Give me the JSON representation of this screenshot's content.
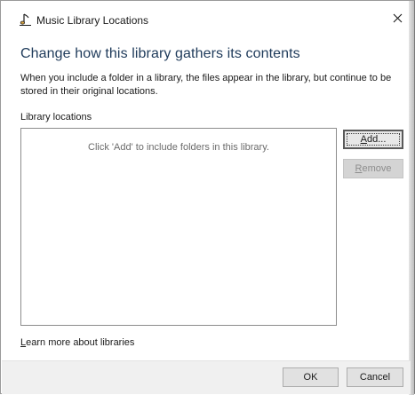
{
  "window": {
    "title": "Music Library Locations",
    "close_glyph": "×",
    "title_icon": "music-note-icon"
  },
  "main": {
    "heading": "Change how this library gathers its contents",
    "description": "When you include a folder in a library, the files appear in the library, but continue to be stored in their original locations.",
    "section_label": "Library locations",
    "locations_hint": "Click 'Add' to include folders in this library."
  },
  "buttons": {
    "add": {
      "mnemonic": "A",
      "rest": "dd..."
    },
    "remove": {
      "mnemonic": "R",
      "rest": "emove"
    },
    "ok": "OK",
    "cancel": "Cancel"
  },
  "link": {
    "mnemonic": "L",
    "rest": "earn more about libraries"
  },
  "colors": {
    "heading": "#1e3a5a",
    "footer": "#f0f0f0",
    "button_face": "#e1e1e1",
    "disabled_text": "#8d8d8d"
  }
}
